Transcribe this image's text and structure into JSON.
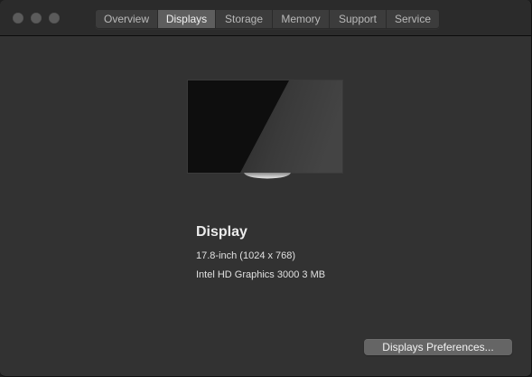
{
  "tabs": [
    {
      "label": "Overview",
      "active": false
    },
    {
      "label": "Displays",
      "active": true
    },
    {
      "label": "Storage",
      "active": false
    },
    {
      "label": "Memory",
      "active": false
    },
    {
      "label": "Support",
      "active": false
    },
    {
      "label": "Service",
      "active": false
    }
  ],
  "display": {
    "title": "Display",
    "size_resolution": "17.8-inch (1024 x 768)",
    "graphics": "Intel HD Graphics 3000 3 MB"
  },
  "buttons": {
    "preferences_label": "Displays Preferences..."
  },
  "colors": {
    "window_bg": "#323232",
    "titlebar_bg": "#2b2b2b",
    "active_tab": "#5e5e5e",
    "button_bg": "#656565"
  },
  "icons": {
    "traffic_lights": [
      "close-icon",
      "minimize-icon",
      "zoom-icon"
    ],
    "monitor": "display-monitor-icon"
  }
}
